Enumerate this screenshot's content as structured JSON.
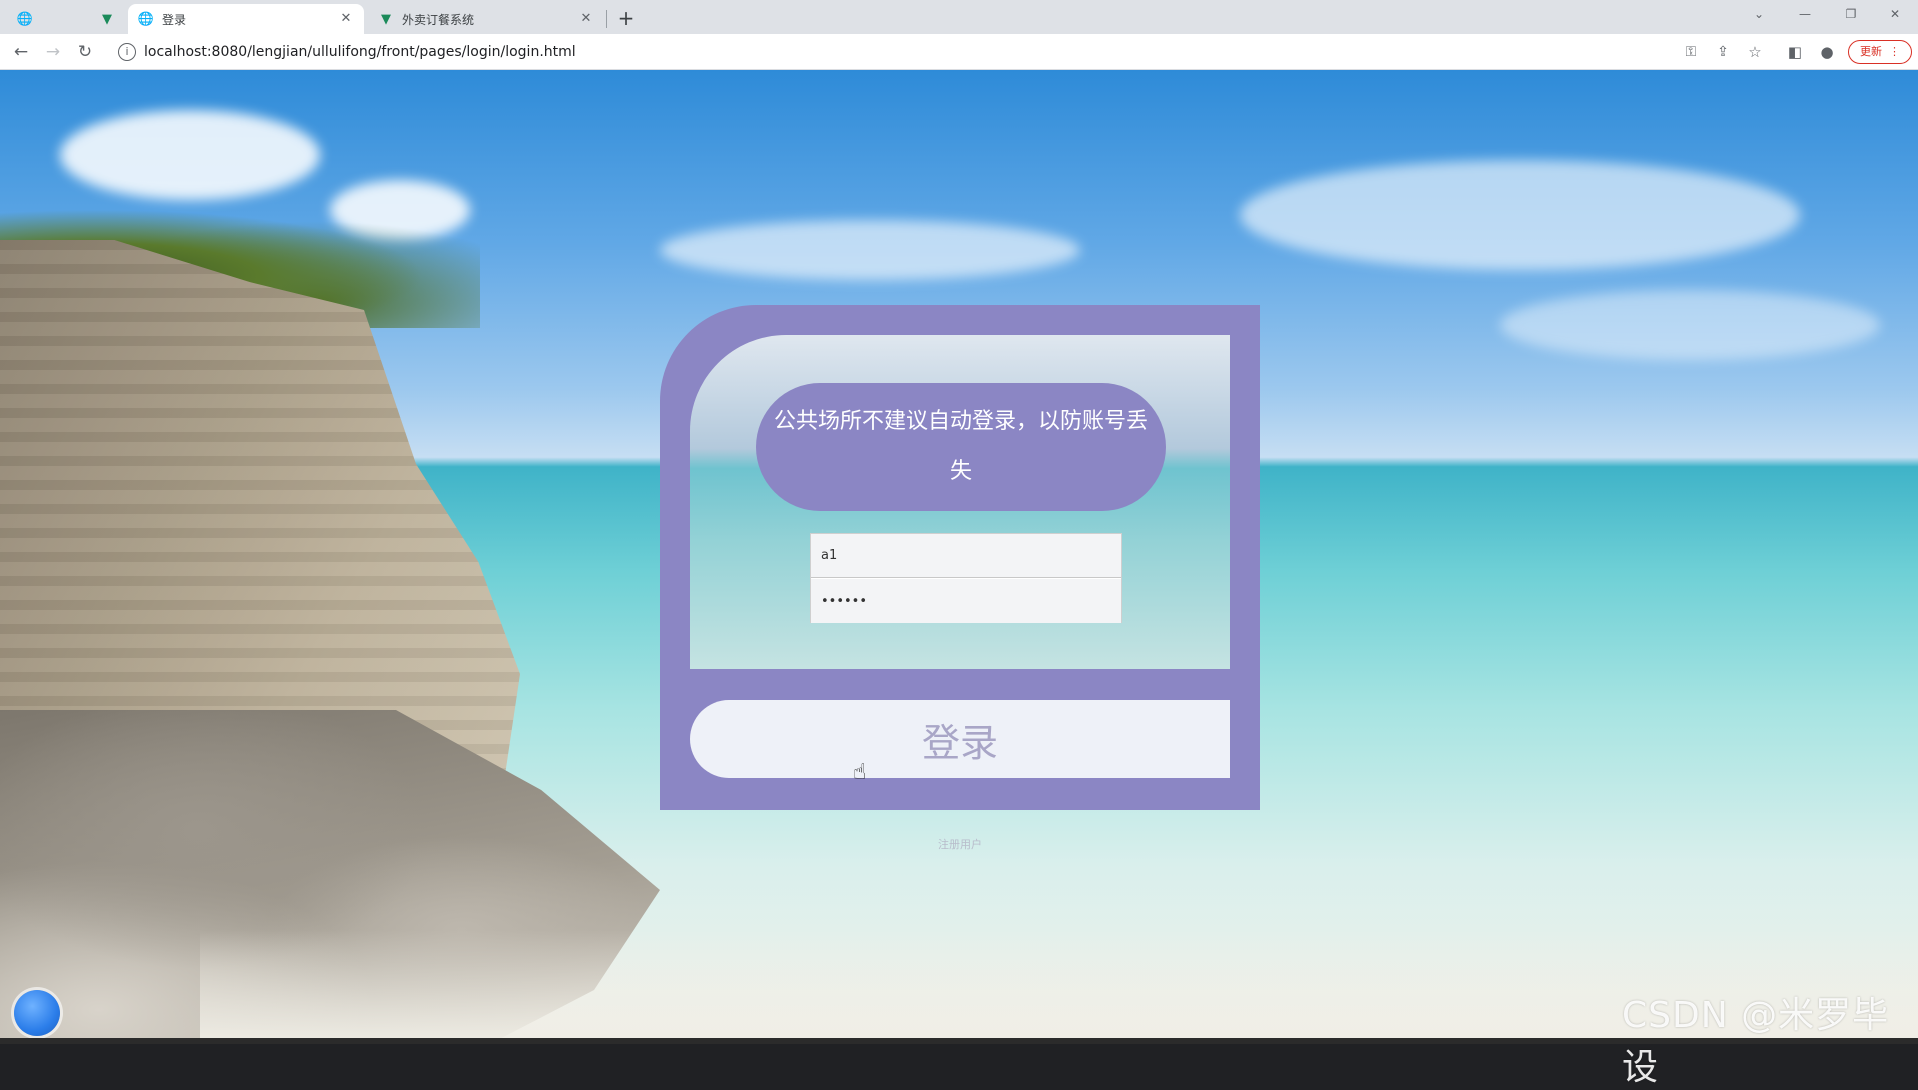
{
  "browser": {
    "tabs": [
      {
        "title": "登录",
        "active": true
      },
      {
        "title": "外卖订餐系统",
        "active": false
      }
    ],
    "new_tab_label": "+",
    "address": "localhost:8080/lengjian/ullulifong/front/pages/login/login.html",
    "update_label": "更新"
  },
  "login": {
    "notice": "公共场所不建议自动登录，以防账号丢失",
    "username_value": "a1",
    "password_value": "••••••",
    "submit_label": "登录",
    "register_label": "注册用户"
  },
  "watermark": "CSDN @米罗毕设",
  "colors": {
    "card_accent": "#8b86c4",
    "button_text": "#a9a6c7"
  }
}
